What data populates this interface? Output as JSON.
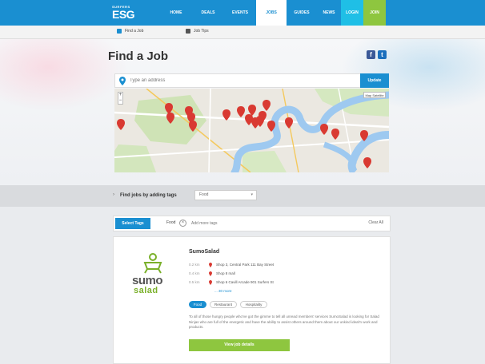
{
  "brand": {
    "logo_small": "SURFERS",
    "logo_big": "ESG"
  },
  "nav": {
    "items": [
      {
        "label": "HOME"
      },
      {
        "label": "DEALS"
      },
      {
        "label": "EVENTS"
      },
      {
        "label": "JOBS"
      },
      {
        "label": "GUIDES"
      },
      {
        "label": "NEWS"
      },
      {
        "label": "LOGIN"
      },
      {
        "label": "JOIN"
      }
    ]
  },
  "breadcrumb": {
    "find_label": "Find a Job",
    "post_label": "Job Tips"
  },
  "page": {
    "title": "Find a Job"
  },
  "social": {
    "facebook": "f",
    "twitter": "t"
  },
  "search": {
    "placeholder": "Type an address",
    "button_label": "Update"
  },
  "map": {
    "zoom_plus": "+",
    "zoom_minus": "−",
    "type_label": "Map  Satellite"
  },
  "filter": {
    "label": "Find jobs by adding tags",
    "select_value": "Food",
    "arrow": "›",
    "caret": "▾"
  },
  "tags": {
    "button_label": "Select Tags",
    "active_tag": "Food",
    "remove_symbol": "×",
    "input_placeholder": "Add more tags",
    "clear_label": "Clear All"
  },
  "listing": {
    "name": "SumoSalad",
    "logo_word_1": "sumo",
    "logo_word_2": "salad",
    "locations": [
      {
        "distance": "0.2 km",
        "address": "Shop 3, Central Park 111 Bay Street"
      },
      {
        "distance": "0.4 km",
        "address": "Shop 8 mall"
      },
      {
        "distance": "0.5 km",
        "address": "Shop 6 Cavill Arcade 901 Surfers St"
      }
    ],
    "more_label": "... 30 more",
    "chips": [
      "Food",
      "Restaurant",
      "Hospitality"
    ],
    "description": "To all of those hungry people who've got the gimme to tell all unread members' services SumoSalad is looking for Salad Ninjas who are full of the energetic and have the ability to assist others around them about our unkind ideal'n work and products.",
    "cta_label": "View job details"
  },
  "colors": {
    "primary": "#1a8fd1",
    "accent_green": "#8ec63f",
    "accent_cyan": "#1fbfe6",
    "pin_red": "#d93a32"
  }
}
